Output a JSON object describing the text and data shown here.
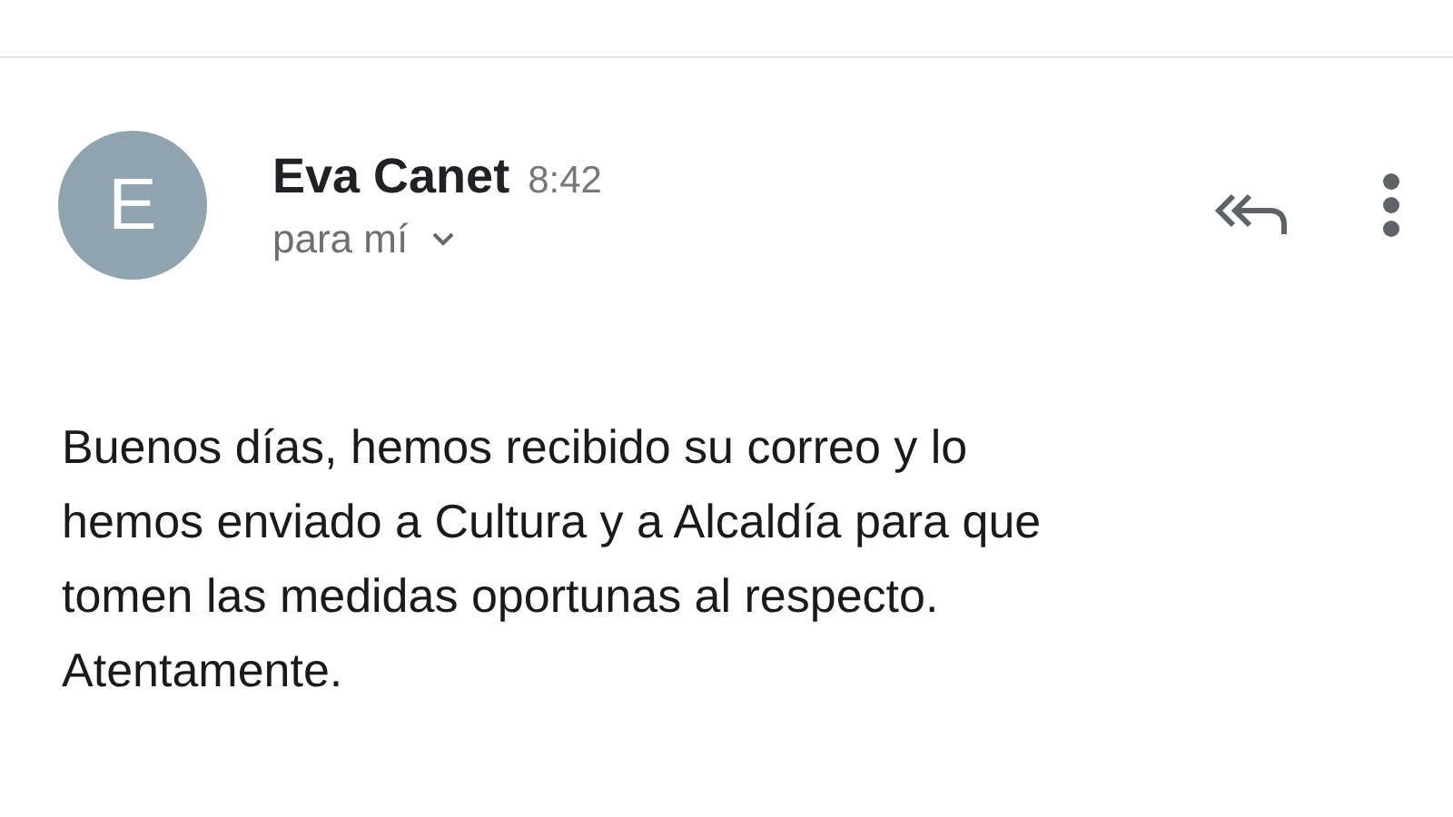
{
  "message": {
    "avatar_letter": "E",
    "sender": "Eva Canet",
    "time": "8:42",
    "recipient": "para mí",
    "body_lines": [
      "Buenos días, hemos recibido su correo y lo",
      "hemos enviado a Cultura y a Alcaldía para que",
      "tomen las medidas oportunas al respecto.",
      "Atentamente."
    ]
  }
}
